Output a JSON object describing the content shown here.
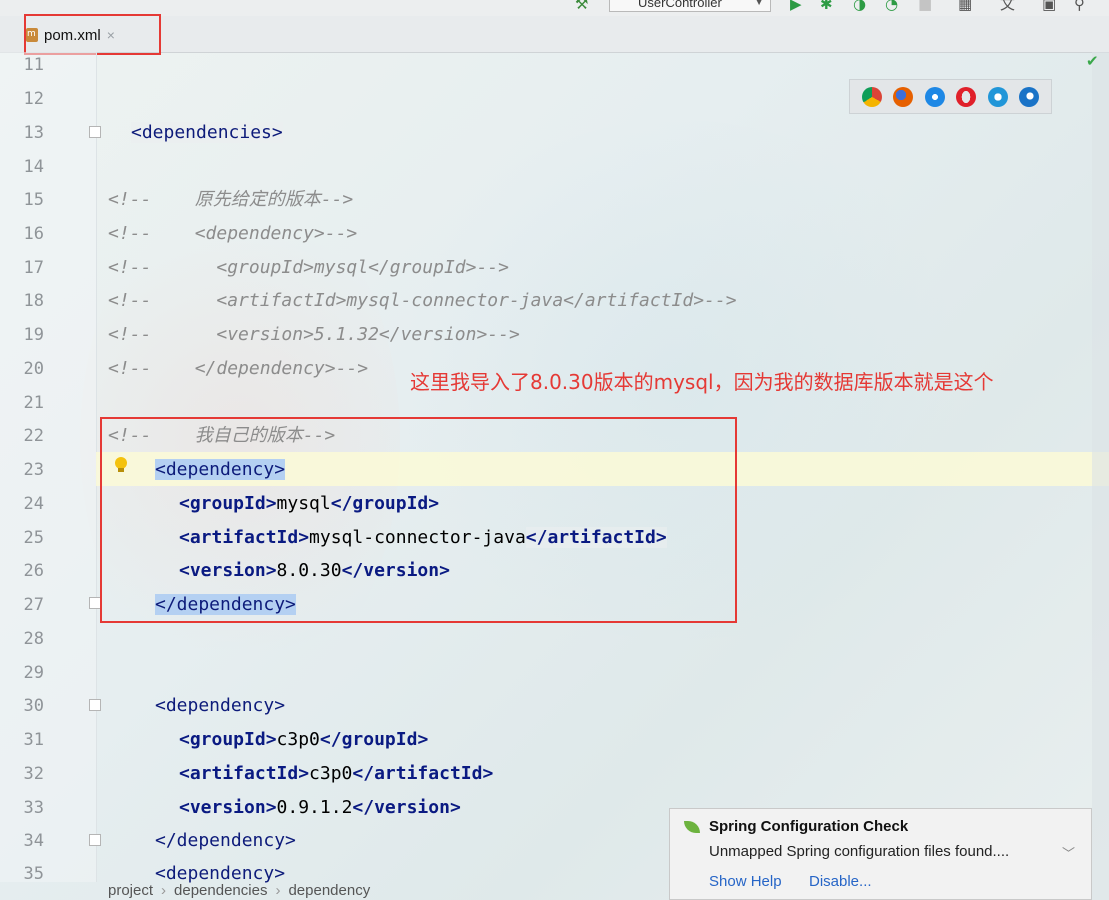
{
  "toolbar": {
    "run_config": "UserController"
  },
  "tab": {
    "filename": "pom.xml",
    "close": "×"
  },
  "editor": {
    "lines": [
      {
        "n": "11"
      },
      {
        "n": "12"
      },
      {
        "n": "13"
      },
      {
        "n": "14"
      },
      {
        "n": "15"
      },
      {
        "n": "16"
      },
      {
        "n": "17"
      },
      {
        "n": "18"
      },
      {
        "n": "19"
      },
      {
        "n": "20"
      },
      {
        "n": "21"
      },
      {
        "n": "22"
      },
      {
        "n": "23"
      },
      {
        "n": "24"
      },
      {
        "n": "25"
      },
      {
        "n": "26"
      },
      {
        "n": "27"
      },
      {
        "n": "28"
      },
      {
        "n": "29"
      },
      {
        "n": "30"
      },
      {
        "n": "31"
      },
      {
        "n": "32"
      },
      {
        "n": "33"
      },
      {
        "n": "34"
      },
      {
        "n": "35"
      }
    ],
    "code": {
      "l13": "<dependencies>",
      "l15": "<!--    原先给定的版本-->",
      "l16": "<!--    <dependency>-->",
      "l17": "<!--      <groupId>mysql</groupId>-->",
      "l18": "<!--      <artifactId>mysql-connector-java</artifactId>-->",
      "l19": "<!--      <version>5.1.32</version>-->",
      "l20": "<!--    </dependency>-->",
      "l22": "<!--    我自己的版本-->",
      "l23": "<dependency>",
      "l24_open": "<groupId>",
      "l24_val": "mysql",
      "l24_close": "</groupId>",
      "l25_open": "<artifactId>",
      "l25_val": "mysql-connector-java",
      "l25_close": "</artifactId>",
      "l26_open": "<version>",
      "l26_val": "8.0.30",
      "l26_close": "</version>",
      "l27": "</dependency>",
      "l30": "<dependency>",
      "l31_open": "<groupId>",
      "l31_val": "c3p0",
      "l31_close": "</groupId>",
      "l32_open": "<artifactId>",
      "l32_val": "c3p0",
      "l32_close": "</artifactId>",
      "l33_open": "<version>",
      "l33_val": "0.9.1.2",
      "l33_close": "</version>",
      "l34": "</dependency>",
      "l35": "<dependency>"
    }
  },
  "annotation": "这里我导入了8.0.30版本的mysql，因为我的数据库版本就是这个",
  "browsers": [
    "chrome-icon",
    "firefox-icon",
    "safari-icon",
    "opera-icon",
    "ie-icon",
    "edge-icon"
  ],
  "notification": {
    "title": "Spring Configuration Check",
    "message": "Unmapped Spring configuration files found....",
    "show_help": "Show Help",
    "disable": "Disable..."
  },
  "breadcrumb": [
    "project",
    "dependencies",
    "dependency"
  ],
  "colors": {
    "accent_red": "#e53935",
    "link_blue": "#2665c7",
    "tag_blue": "#0d1b7a",
    "comment_gray": "#8c8c8c"
  }
}
